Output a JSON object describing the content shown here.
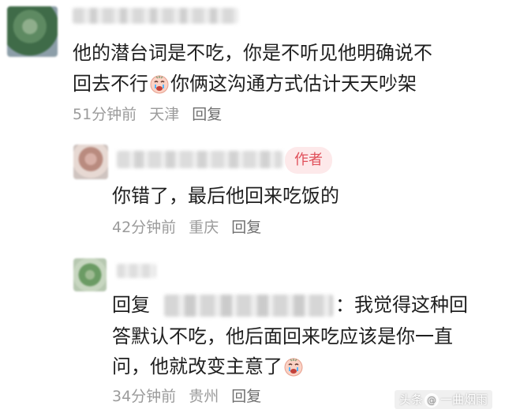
{
  "comments": [
    {
      "text_line1": "他的潜台词是不吃，你是不听见他明确说不",
      "text_line2_before": "回去不行",
      "text_line2_after": "你俩这沟通方式估计天天吵架",
      "emoji_icon": "crying-face-icon",
      "time": "51分钟前",
      "location": "天津",
      "reply_label": "回复"
    },
    {
      "author_badge": "作者",
      "text": "你错了，最后他回来吃饭的",
      "time": "42分钟前",
      "location": "重庆",
      "reply_label": "回复"
    },
    {
      "reply_prefix": "回复",
      "colon": "：",
      "text_line1": "我觉得这种回",
      "text_line2": "答默认不吃，他后面回来吃应该是你一直",
      "text_line3": "问，他就改变主意了",
      "emoji_icon": "crying-face-icon",
      "time": "34分钟前",
      "location": "贵州",
      "reply_label": "回复"
    }
  ],
  "watermark": {
    "prefix": "头条",
    "handle": "一曲烟雨"
  }
}
